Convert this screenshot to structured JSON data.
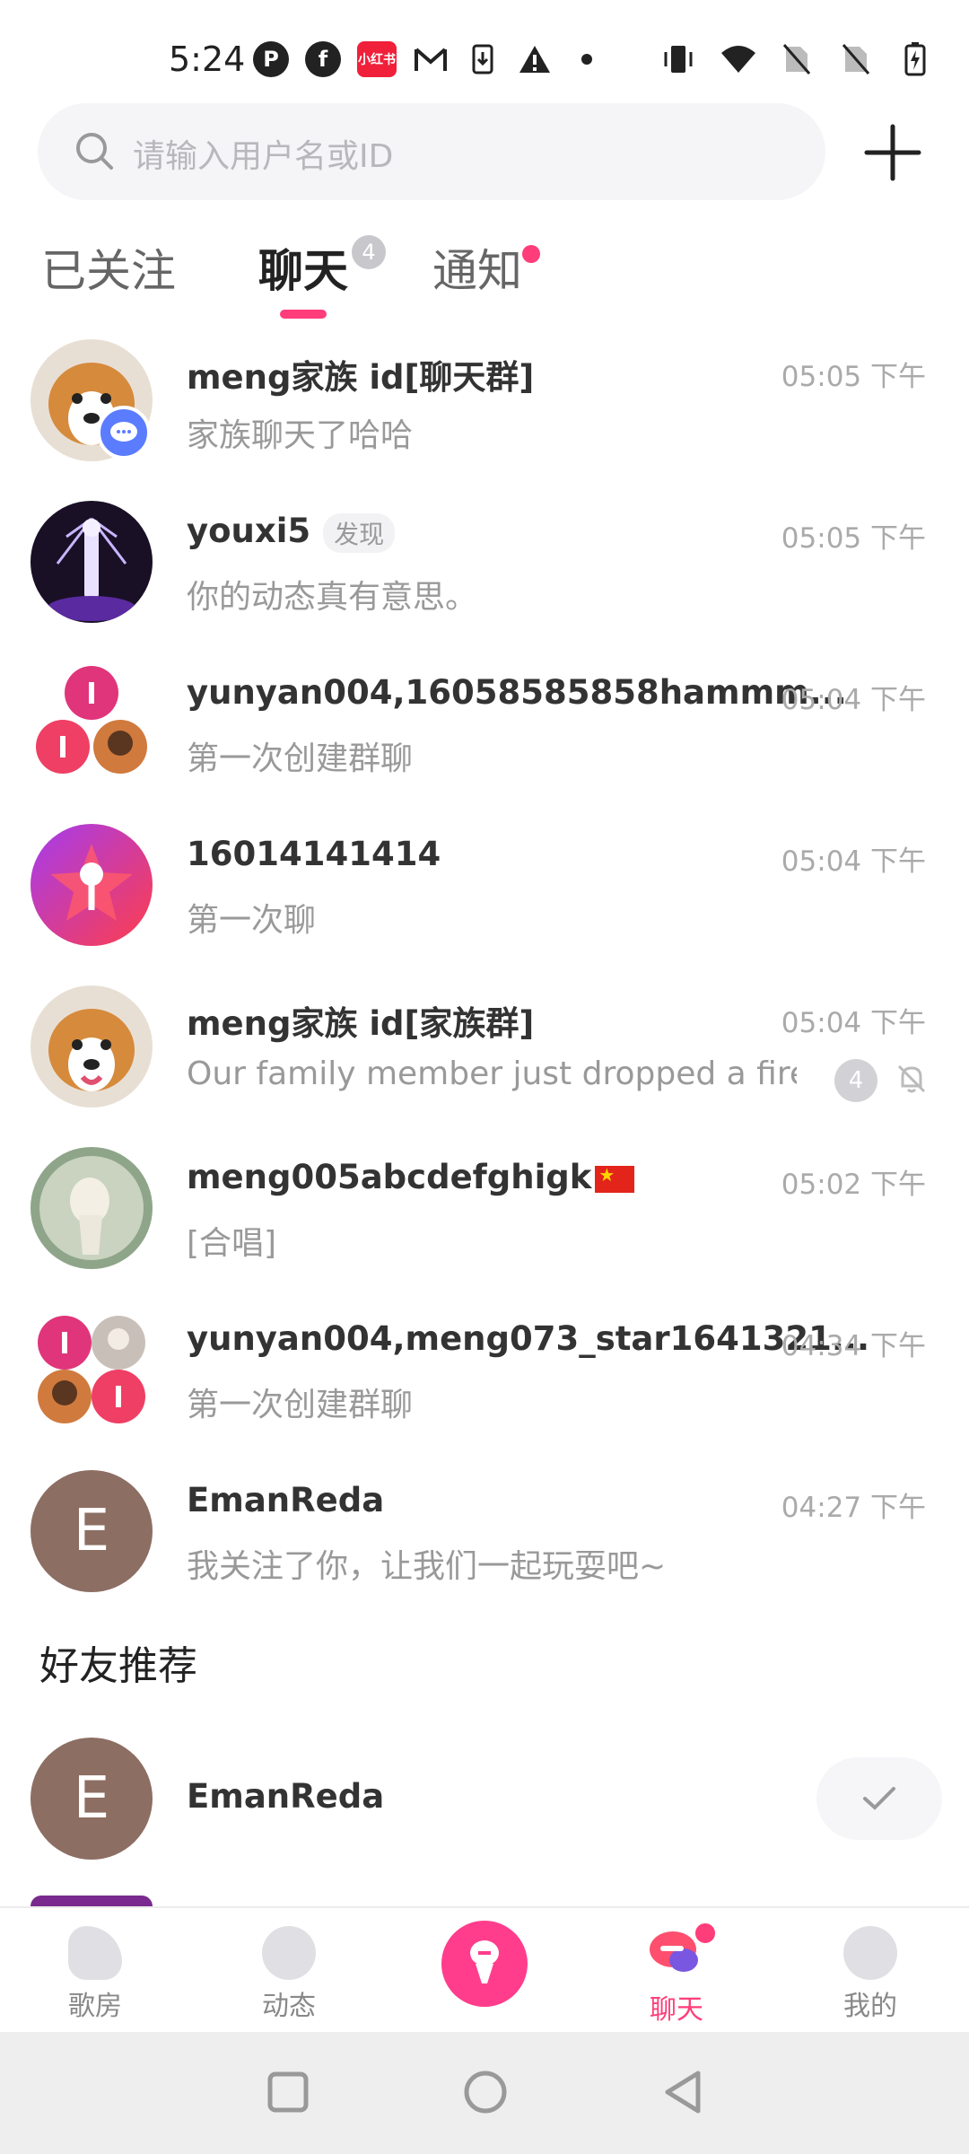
{
  "status_bar": {
    "time": "5:24",
    "left_icons": [
      "p-icon",
      "facebook-icon",
      "xiaohongshu-icon",
      "gmail-icon",
      "download-icon",
      "warning-icon",
      "dot-icon"
    ],
    "xiaohongshu_text": "小红书",
    "right_icons": [
      "vibrate-icon",
      "wifi-icon",
      "no-sim-icon",
      "no-sim-icon",
      "battery-charging-icon"
    ]
  },
  "search": {
    "placeholder": "请输入用户名或ID"
  },
  "tabs": [
    {
      "label": "已关注"
    },
    {
      "label": "聊天",
      "badge": "4"
    },
    {
      "label": "通知"
    }
  ],
  "conversations": [
    {
      "name": "meng家族 id[聊天群]",
      "message": "家族聊天了哈哈",
      "time": "05:05 下午"
    },
    {
      "name": "youxi5",
      "tag": "发现",
      "message": "你的动态真有意思。",
      "time": "05:05 下午"
    },
    {
      "name": "yunyan004,16058585858hammm...",
      "message": "第一次创建群聊",
      "time": "05:04 下午"
    },
    {
      "name": "16014141414",
      "message": "第一次聊",
      "time": "05:04 下午"
    },
    {
      "name": "meng家族 id[家族群]",
      "message": "Our family member just dropped a fire c...",
      "time": "05:04 下午",
      "unread": "4"
    },
    {
      "name": "meng005abcdefghigk",
      "message": "[合唱]",
      "time": "05:02 下午"
    },
    {
      "name": "yunyan004,meng073_star1641321...",
      "message": "第一次创建群聊",
      "time": "04:34 下午"
    },
    {
      "name": "EmanReda",
      "avatar_letter": "E",
      "message": "我关注了你，让我们一起玩耍吧~",
      "time": "04:27 下午"
    }
  ],
  "recommend": {
    "title": "好友推荐",
    "items": [
      {
        "name": "EmanReda",
        "avatar_letter": "E"
      }
    ]
  },
  "bottom_nav": [
    {
      "label": "歌房"
    },
    {
      "label": "动态"
    },
    {
      "label": ""
    },
    {
      "label": "聊天",
      "active": true
    },
    {
      "label": "我的"
    }
  ],
  "colors": {
    "accent": "#ff3d7a",
    "avatar_brown": "#8d6e63"
  }
}
